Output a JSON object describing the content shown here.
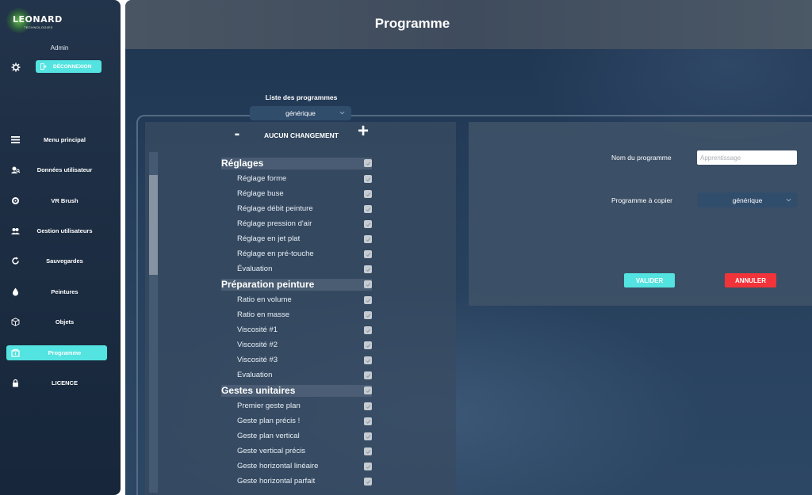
{
  "sidebar": {
    "logo": {
      "name": "LEONARD",
      "sub": "TECHNOLOGIES"
    },
    "user_label": "Admin",
    "logout_label": "DÉCONNEXION",
    "items": [
      {
        "label": "Menu principal",
        "icon": "menu-icon"
      },
      {
        "label": "Données utilisateur",
        "icon": "user-data-icon"
      },
      {
        "label": "VR Brush",
        "icon": "vr-brush-icon"
      },
      {
        "label": "Gestion utilisateurs",
        "icon": "users-icon"
      },
      {
        "label": "Sauvegardes",
        "icon": "refresh-icon"
      },
      {
        "label": "Peintures",
        "icon": "drop-icon"
      },
      {
        "label": "Objets",
        "icon": "cube-icon"
      },
      {
        "label": "Programme",
        "icon": "program-icon",
        "active": true
      },
      {
        "label": "LICENCE",
        "icon": "lock-icon"
      }
    ]
  },
  "header": {
    "title": "Programme"
  },
  "program_list": {
    "title": "Liste des programmes",
    "selected": "générique",
    "no_change_label": "AUCUN CHANGEMENT",
    "minus": "-",
    "plus": "+"
  },
  "tree": [
    {
      "type": "cat",
      "label": "Réglages",
      "checked": true
    },
    {
      "type": "item",
      "label": "Réglage forme",
      "checked": true
    },
    {
      "type": "item",
      "label": "Réglage buse",
      "checked": true
    },
    {
      "type": "item",
      "label": "Réglage débit peinture",
      "checked": true
    },
    {
      "type": "item",
      "label": "Réglage pression d'air",
      "checked": true
    },
    {
      "type": "item",
      "label": "Réglage en jet plat",
      "checked": true
    },
    {
      "type": "item",
      "label": "Réglage en pré-touche",
      "checked": true
    },
    {
      "type": "item",
      "label": "Évaluation",
      "checked": true
    },
    {
      "type": "cat",
      "label": "Préparation peinture",
      "checked": true
    },
    {
      "type": "item",
      "label": "Ratio en volume",
      "checked": true
    },
    {
      "type": "item",
      "label": "Ratio en masse",
      "checked": true
    },
    {
      "type": "item",
      "label": "Viscosité #1",
      "checked": true
    },
    {
      "type": "item",
      "label": "Viscosité #2",
      "checked": true
    },
    {
      "type": "item",
      "label": "Viscosité #3",
      "checked": true
    },
    {
      "type": "item",
      "label": "Evaluation",
      "checked": true
    },
    {
      "type": "cat",
      "label": "Gestes unitaires",
      "checked": true
    },
    {
      "type": "item",
      "label": "Premier geste plan",
      "checked": true
    },
    {
      "type": "item",
      "label": "Geste plan précis !",
      "checked": true
    },
    {
      "type": "item",
      "label": "Geste plan vertical",
      "checked": true
    },
    {
      "type": "item",
      "label": "Geste vertical précis",
      "checked": true
    },
    {
      "type": "item",
      "label": "Geste horizontal linéaire",
      "checked": true
    },
    {
      "type": "item",
      "label": "Geste horizontal parfait",
      "checked": true
    }
  ],
  "form": {
    "name_label": "Nom du programme",
    "name_value": "",
    "name_placeholder": "Apprentissage",
    "copy_label": "Programme à copier",
    "copy_selected": "générique",
    "validate_label": "VALIDER",
    "cancel_label": "ANNULER"
  },
  "colors": {
    "accent": "#53e3e0",
    "danger": "#f2343a",
    "sidebar_bg": "#1b2b40"
  }
}
